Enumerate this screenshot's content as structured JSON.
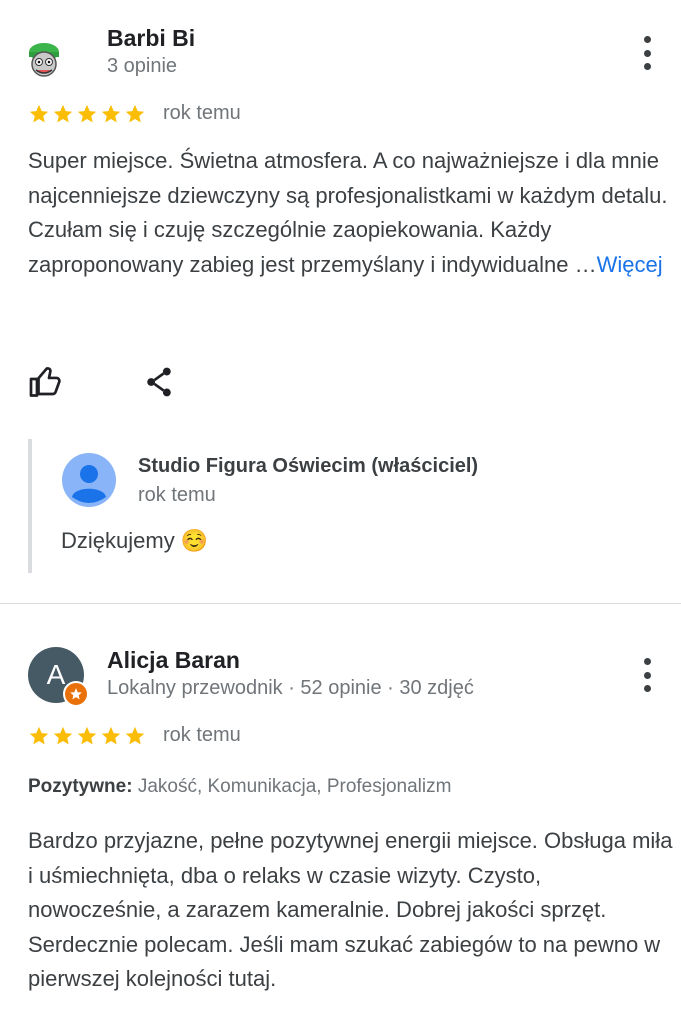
{
  "reviews": [
    {
      "author": "Barbi Bi",
      "meta": "3 opinie",
      "rating": 5,
      "time": "rok temu",
      "text": "Super miejsce. Świetna atmosfera. A co najważniejsze i dla mnie najcenniejsze dziewczyny są profesjonalistkami w każdym detalu. Czułam się i czuję szczególnie zaopiekowania. Każdy zaproponowany zabieg jest przemyślany i indywidualne …",
      "more_label": "Więcej",
      "owner_reply": {
        "author": "Studio Figura Oświecim (właściciel)",
        "time": "rok temu",
        "text": "Dziękujemy ☺️"
      }
    },
    {
      "author": "Alicja Baran",
      "avatar_letter": "A",
      "meta": "Lokalny przewodnik · 52 opinie · 30 zdjęć",
      "rating": 5,
      "time": "rok temu",
      "positives_label": "Pozytywne:",
      "positives": "Jakość, Komunikacja, Profesjonalizm",
      "text": "Bardzo przyjazne, pełne pozytywnej energii miejsce. Obsługa miła i uśmiechnięta, dba o relaks w czasie wizyty. Czysto, nowocześnie, a zarazem kameralnie. Dobrej jakości sprzęt. Serdecznie polecam. Jeśli mam szukać zabiegów to na pewno w pierwszej kolejności tutaj."
    }
  ],
  "icons": {
    "like": "thumb-up-icon",
    "share": "share-icon",
    "menu": "more-vert-icon",
    "star": "star-icon",
    "local_guide": "local-guide-badge-icon"
  },
  "colors": {
    "star": "#fbbc04",
    "link": "#1a73e8",
    "owner_avatar": "#8ab4f8",
    "guide_badge": "#e8710a"
  }
}
